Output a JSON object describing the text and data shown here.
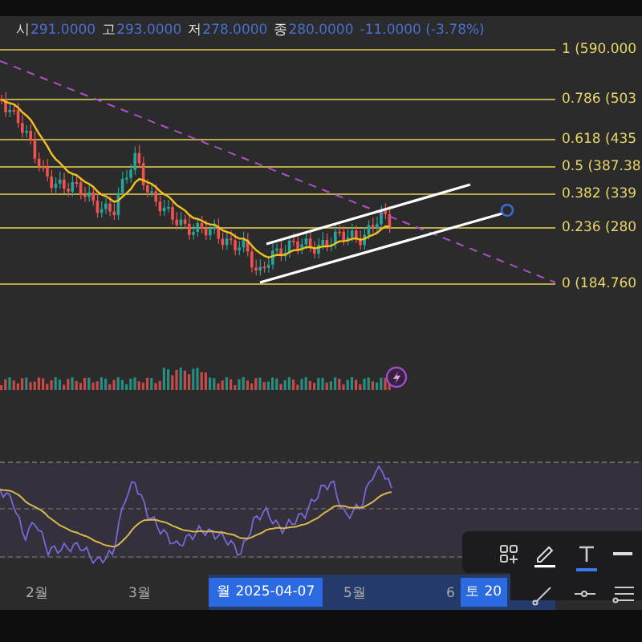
{
  "ohlc": [
    {
      "label": "시",
      "value": "291.0000"
    },
    {
      "label": "고",
      "value": "293.0000"
    },
    {
      "label": "저",
      "value": "278.0000"
    },
    {
      "label": "종",
      "value": "280.0000"
    }
  ],
  "change": "-11.0000 (-3.78%)",
  "fib_levels": [
    {
      "label": "1 (590.000"
    },
    {
      "label": "0.786 (503"
    },
    {
      "label": "0.618 (435"
    },
    {
      "label": "0.5 (387.38"
    },
    {
      "label": "0.382 (339"
    },
    {
      "label": "0.236 (280"
    },
    {
      "label": "0 (184.760"
    }
  ],
  "x_axis": [
    {
      "label": "2월"
    },
    {
      "label": "3월"
    },
    {
      "label": "5월"
    },
    {
      "label": "6"
    }
  ],
  "crosshair_labels": [
    "월 2025-04-07",
    "토 20"
  ],
  "toolbar": [
    {
      "kind": "shapes",
      "selected": false
    },
    {
      "kind": "pencil",
      "selected": false
    },
    {
      "kind": "text",
      "selected": true
    },
    {
      "kind": "line-style",
      "selected": false
    },
    {
      "kind": "trend-line",
      "selected": false
    },
    {
      "kind": "ray",
      "selected": false
    },
    {
      "kind": "parallel",
      "selected": false
    }
  ]
}
